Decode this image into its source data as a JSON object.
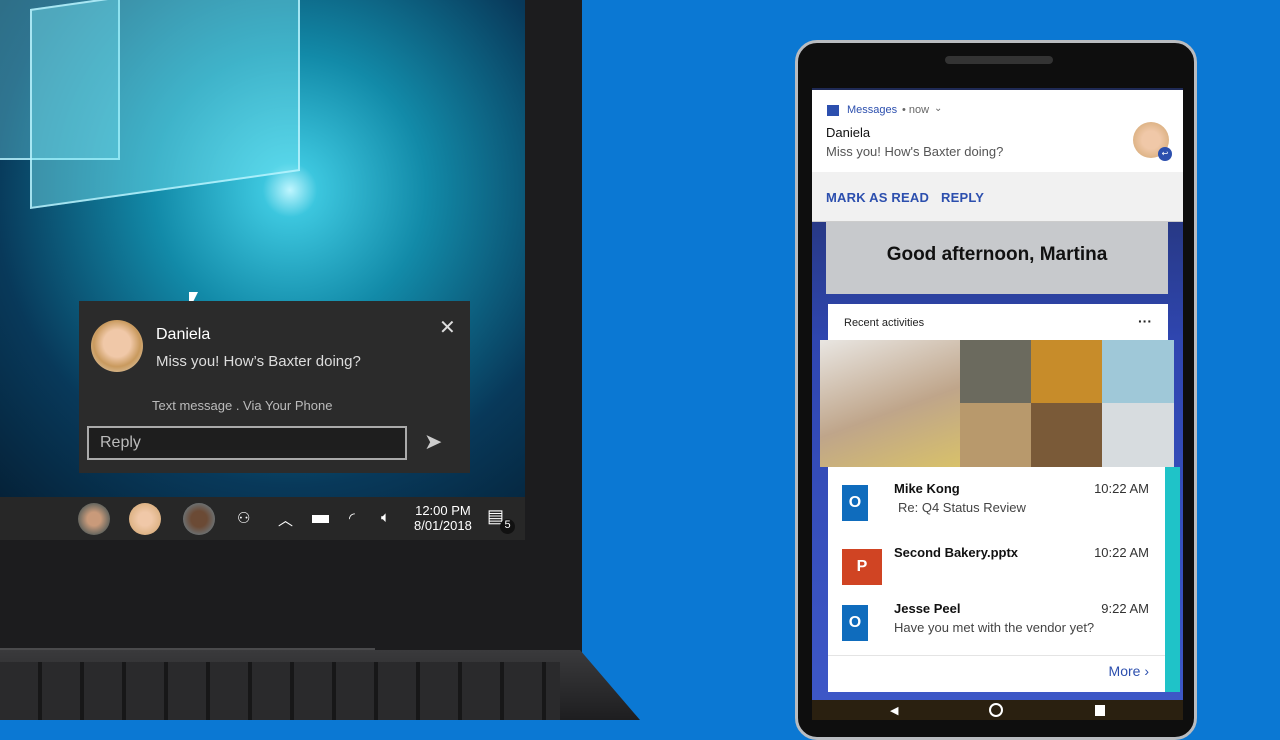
{
  "toast": {
    "sender": "Daniela",
    "message": "Miss you! How’s Baxter doing?",
    "source": "Text message . Via Your Phone",
    "reply_placeholder": "Reply"
  },
  "taskbar": {
    "time": "12:00 PM",
    "date": "8/01/2018",
    "notification_count": "5"
  },
  "phone": {
    "notification": {
      "app": "Messages",
      "time": "• now",
      "sender": "Daniela",
      "message": "Miss you! How's Baxter doing?",
      "actions": [
        "MARK AS READ",
        "REPLY"
      ]
    },
    "greeting": "Good afternoon, Martina",
    "recent_title": "Recent activities",
    "more_menu": "···",
    "items": [
      {
        "title": "Mike Kong",
        "subtitle": "Re: Q4 Status Review",
        "time": "10:22 AM",
        "icon": "outlook-icon"
      },
      {
        "title": "Second Bakery.pptx",
        "subtitle": "",
        "time": "10:22 AM",
        "icon": "powerpoint-icon"
      },
      {
        "title": "Jesse Peel",
        "subtitle": "Have you met with the vendor yet?",
        "time": "9:22 AM",
        "icon": "outlook-icon"
      }
    ],
    "more_label": "More"
  },
  "colors": {
    "background": "#0b78d3",
    "accent": "#2c4fae",
    "teal": "#1fc3c8"
  }
}
